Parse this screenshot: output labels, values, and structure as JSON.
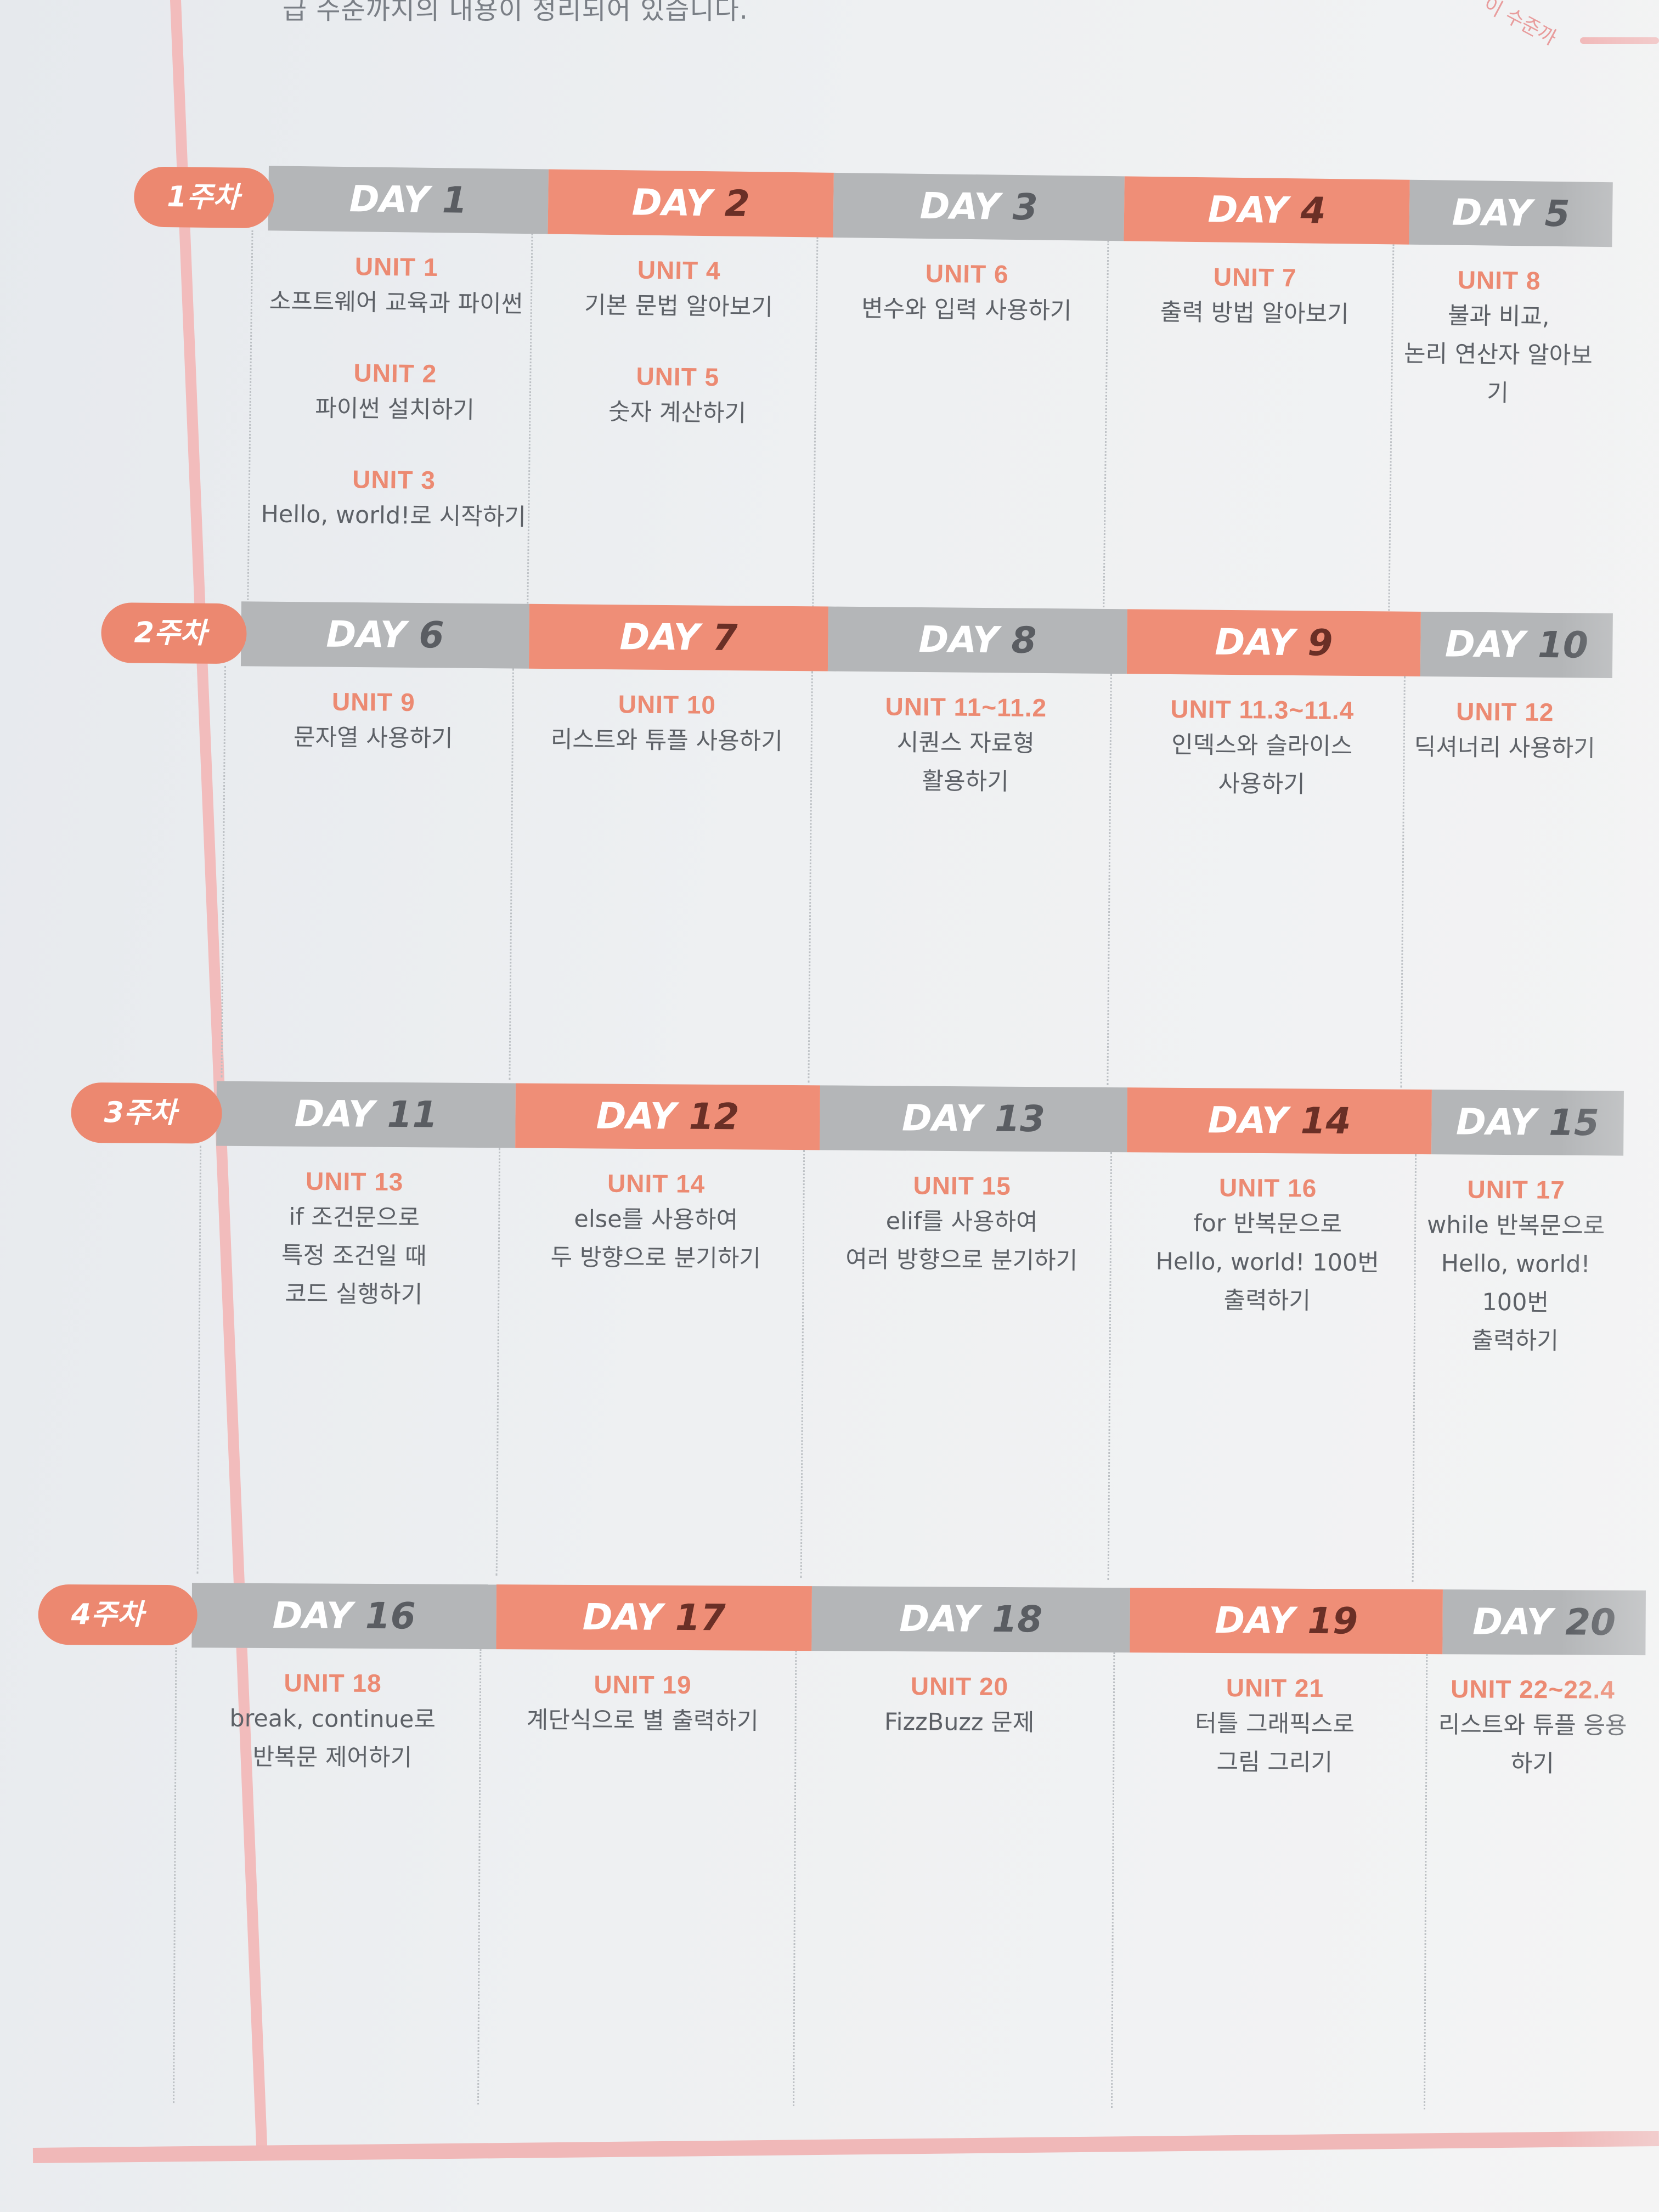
{
  "top_text": "급 수준까지의 내용이 정리되어 있습니다.",
  "corner_text": "이 수준까",
  "colors": {
    "salmon": "#ef8e77",
    "gray": "#b4b6b8",
    "unit_label": "#ec8a72",
    "text": "#5d6167",
    "frame": "#f2bcbc"
  },
  "weeks": [
    {
      "label": "1주차",
      "days": [
        {
          "prefix": "DAY",
          "num": "1",
          "color": "gray",
          "units": [
            {
              "label": "UNIT 1",
              "desc": "소프트웨어 교육과 파이썬"
            },
            {
              "label": "UNIT 2",
              "desc": "파이썬 설치하기"
            },
            {
              "label": "UNIT 3",
              "desc": "Hello, world!로 시작하기"
            }
          ]
        },
        {
          "prefix": "DAY",
          "num": "2",
          "color": "salmon",
          "units": [
            {
              "label": "UNIT 4",
              "desc": "기본 문법 알아보기"
            },
            {
              "label": "UNIT 5",
              "desc": "숫자 계산하기"
            }
          ]
        },
        {
          "prefix": "DAY",
          "num": "3",
          "color": "gray",
          "units": [
            {
              "label": "UNIT 6",
              "desc": "변수와 입력 사용하기"
            }
          ]
        },
        {
          "prefix": "DAY",
          "num": "4",
          "color": "salmon",
          "units": [
            {
              "label": "UNIT 7",
              "desc": "출력 방법 알아보기"
            }
          ]
        },
        {
          "prefix": "DAY",
          "num": "5",
          "color": "gray",
          "units": [
            {
              "label": "UNIT 8",
              "desc": "불과 비교,\n논리 연산자 알아보기"
            }
          ]
        }
      ]
    },
    {
      "label": "2주차",
      "days": [
        {
          "prefix": "DAY",
          "num": "6",
          "color": "gray",
          "units": [
            {
              "label": "UNIT 9",
              "desc": "문자열 사용하기"
            }
          ]
        },
        {
          "prefix": "DAY",
          "num": "7",
          "color": "salmon",
          "units": [
            {
              "label": "UNIT 10",
              "desc": "리스트와 튜플 사용하기"
            }
          ]
        },
        {
          "prefix": "DAY",
          "num": "8",
          "color": "gray",
          "units": [
            {
              "label": "UNIT 11~11.2",
              "desc": "시퀀스 자료형\n활용하기"
            }
          ]
        },
        {
          "prefix": "DAY",
          "num": "9",
          "color": "salmon",
          "units": [
            {
              "label": "UNIT 11.3~11.4",
              "desc": "인덱스와 슬라이스\n사용하기"
            }
          ]
        },
        {
          "prefix": "DAY",
          "num": "10",
          "color": "gray",
          "units": [
            {
              "label": "UNIT 12",
              "desc": "딕셔너리 사용하기"
            }
          ]
        }
      ]
    },
    {
      "label": "3주차",
      "days": [
        {
          "prefix": "DAY",
          "num": "11",
          "color": "gray",
          "units": [
            {
              "label": "UNIT 13",
              "desc": "if 조건문으로\n특정 조건일 때\n코드 실행하기"
            }
          ]
        },
        {
          "prefix": "DAY",
          "num": "12",
          "color": "salmon",
          "units": [
            {
              "label": "UNIT 14",
              "desc": "else를 사용하여\n두 방향으로 분기하기"
            }
          ]
        },
        {
          "prefix": "DAY",
          "num": "13",
          "color": "gray",
          "units": [
            {
              "label": "UNIT 15",
              "desc": "elif를 사용하여\n여러 방향으로 분기하기"
            }
          ]
        },
        {
          "prefix": "DAY",
          "num": "14",
          "color": "salmon",
          "units": [
            {
              "label": "UNIT 16",
              "desc": "for 반복문으로\nHello, world! 100번\n출력하기"
            }
          ]
        },
        {
          "prefix": "DAY",
          "num": "15",
          "color": "gray",
          "units": [
            {
              "label": "UNIT 17",
              "desc": "while 반복문으로\nHello, world! 100번\n출력하기"
            }
          ]
        }
      ]
    },
    {
      "label": "4주차",
      "days": [
        {
          "prefix": "DAY",
          "num": "16",
          "color": "gray",
          "units": [
            {
              "label": "UNIT 18",
              "desc": "break, continue로\n반복문 제어하기"
            }
          ]
        },
        {
          "prefix": "DAY",
          "num": "17",
          "color": "salmon",
          "units": [
            {
              "label": "UNIT 19",
              "desc": "계단식으로 별 출력하기"
            }
          ]
        },
        {
          "prefix": "DAY",
          "num": "18",
          "color": "gray",
          "units": [
            {
              "label": "UNIT 20",
              "desc": "FizzBuzz 문제"
            }
          ]
        },
        {
          "prefix": "DAY",
          "num": "19",
          "color": "salmon",
          "units": [
            {
              "label": "UNIT 21",
              "desc": "터틀 그래픽스로\n그림 그리기"
            }
          ]
        },
        {
          "prefix": "DAY",
          "num": "20",
          "color": "gray",
          "units": [
            {
              "label": "UNIT 22~22.4",
              "desc": "리스트와 튜플 응용하기"
            }
          ]
        }
      ]
    }
  ]
}
